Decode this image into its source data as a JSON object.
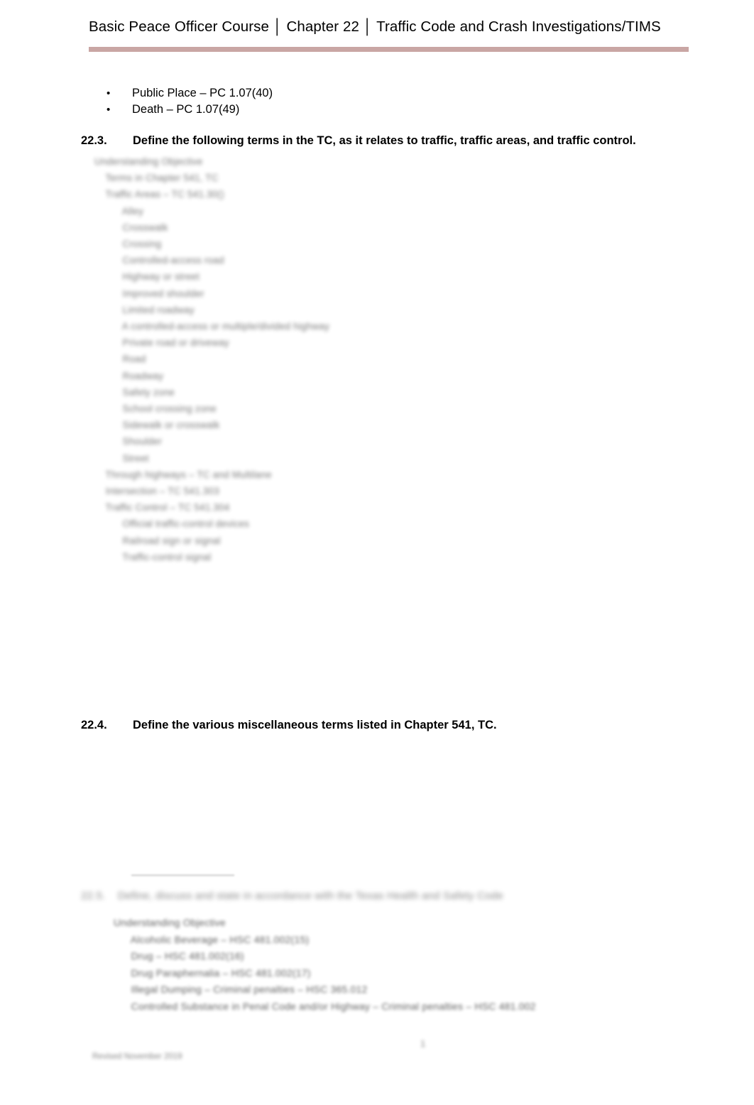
{
  "header": {
    "title": "Basic Peace Officer Course │ Chapter 22 │ Traffic Code and Crash Investigations/TIMS"
  },
  "bullets": [
    {
      "marker": "•",
      "text": "Public Place – PC 1.07(40)"
    },
    {
      "marker": "•",
      "text": "Death – PC 1.07(49)"
    }
  ],
  "objectives": [
    {
      "number": "22.3.",
      "text": "Define the following terms in the TC, as it relates to traffic, traffic areas, and traffic control."
    },
    {
      "number": "22.4.",
      "text": "Define the various miscellaneous terms listed in Chapter 541, TC."
    }
  ],
  "redacted": {
    "section_223": "Understanding Objective\n    Terms in Chapter 541, TC\n    Traffic Areas – TC 541.30()\n          Alley\n          Crosswalk\n          Crossing\n          Controlled-access road\n          Highway or street\n          Improved shoulder\n          Limited roadway\n          A controlled-access or multiple/divided highway\n          Private road or driveway\n          Road\n          Roadway\n          Safety zone\n          School crossing zone\n          Sidewalk or crosswalk\n          Shoulder\n          Street\n    Through highways – TC and Multilane\n    Intersection – TC 541.303\n    Traffic Control – TC 541.304\n          Official traffic-control devices\n          Railroad sign or signal\n          Traffic-control signal",
    "section_225_heading": "22.5.    Define, discuss and state in accordance with the Texas Health and Safety Code",
    "section_225_body": "Understanding Objective\n      Alcoholic Beverage – HSC 481.002(15)\n      Drug – HSC 481.002(16)\n      Drug Paraphernalia – HSC 481.002(17)\n      Illegal Dumping – Criminal penalties – HSC 365.012\n      Controlled Substance in Penal Code and/or Highway – Criminal penalties – HSC 481.002"
  },
  "footer": {
    "page_number": "1",
    "note": "Revised November 2019"
  }
}
